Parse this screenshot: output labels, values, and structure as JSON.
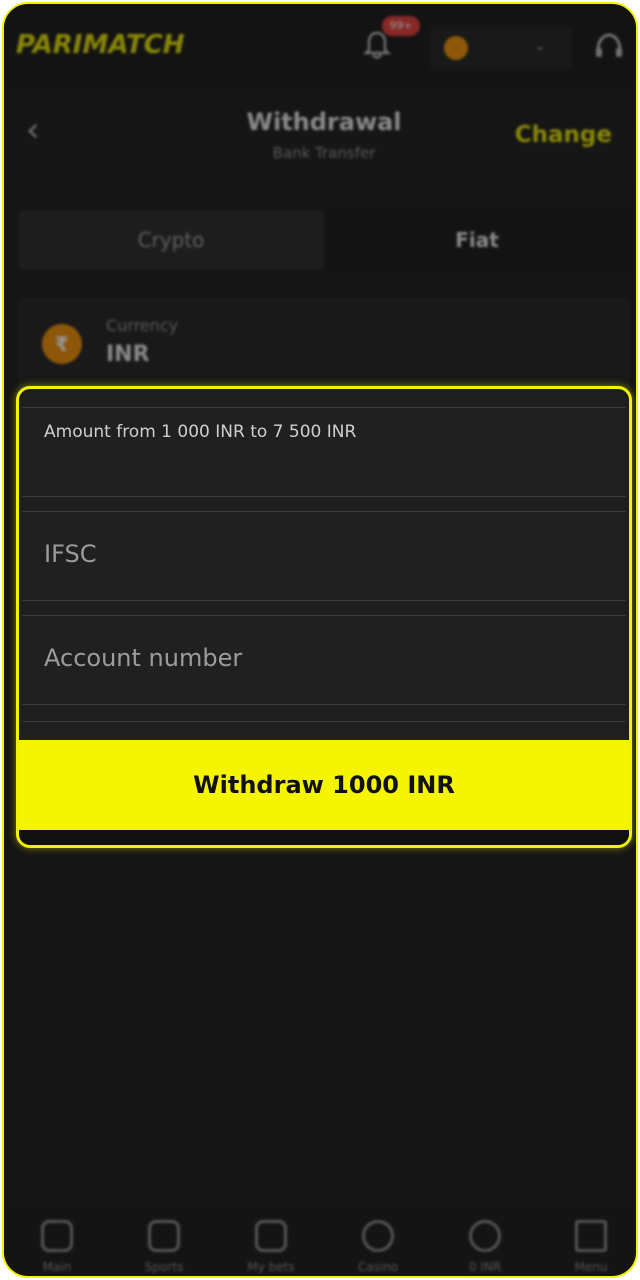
{
  "app": {
    "logo": "PARIMATCH",
    "notification_count": "99+"
  },
  "header": {
    "title": "Withdrawal",
    "subtitle": "Bank Transfer",
    "change_label": "Change"
  },
  "tabs": [
    {
      "label": "Crypto",
      "active": false
    },
    {
      "label": "Fiat",
      "active": true
    }
  ],
  "currency": {
    "label": "Currency",
    "value": "INR",
    "symbol": "₹"
  },
  "form": {
    "amount_label": "Amount from 1 000 INR to 7 500 INR",
    "ifsc_placeholder": "IFSC",
    "account_placeholder": "Account number",
    "submit_label": "Withdraw 1000 INR"
  },
  "nav": [
    {
      "label": "Main",
      "icon": "home-icon"
    },
    {
      "label": "Sports",
      "icon": "sports-icon"
    },
    {
      "label": "My bets",
      "icon": "bets-icon"
    },
    {
      "label": "Casino",
      "icon": "casino-icon"
    },
    {
      "label": "0 INR",
      "icon": "wallet-icon"
    },
    {
      "label": "Menu",
      "icon": "menu-icon"
    }
  ],
  "colors": {
    "accent": "#f5f500",
    "background": "#151515",
    "coin": "#f08c00",
    "badge": "#e53935"
  }
}
